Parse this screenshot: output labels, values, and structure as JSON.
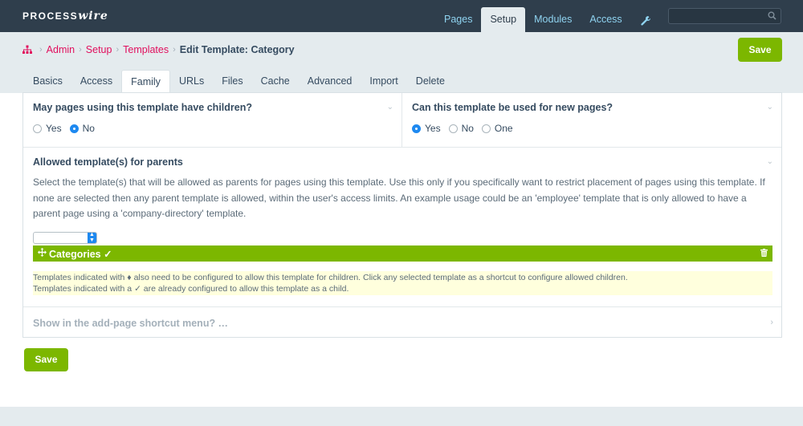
{
  "logo": {
    "process": "PROCESS",
    "wire": "wire"
  },
  "topnav": [
    {
      "label": "Pages",
      "active": false
    },
    {
      "label": "Setup",
      "active": true
    },
    {
      "label": "Modules",
      "active": false
    },
    {
      "label": "Access",
      "active": false
    }
  ],
  "search": {
    "placeholder": ""
  },
  "breadcrumb": {
    "items": [
      "Admin",
      "Setup",
      "Templates"
    ],
    "current": "Edit Template: Category"
  },
  "save_label": "Save",
  "tabs": [
    {
      "label": "Basics",
      "active": false
    },
    {
      "label": "Access",
      "active": false
    },
    {
      "label": "Family",
      "active": true
    },
    {
      "label": "URLs",
      "active": false
    },
    {
      "label": "Files",
      "active": false
    },
    {
      "label": "Cache",
      "active": false
    },
    {
      "label": "Advanced",
      "active": false
    },
    {
      "label": "Import",
      "active": false
    },
    {
      "label": "Delete",
      "active": false
    }
  ],
  "fields": {
    "children": {
      "label": "May pages using this template have children?",
      "options": [
        {
          "label": "Yes",
          "checked": false
        },
        {
          "label": "No",
          "checked": true
        }
      ]
    },
    "new_pages": {
      "label": "Can this template be used for new pages?",
      "options": [
        {
          "label": "Yes",
          "checked": true
        },
        {
          "label": "No",
          "checked": false
        },
        {
          "label": "One",
          "checked": false
        }
      ]
    },
    "parents": {
      "label": "Allowed template(s) for parents",
      "description": "Select the template(s) that will be allowed as parents for pages using this template. Use this only if you specifically want to restrict placement of pages using this template. If none are selected then any parent template is allowed, within the user's access limits. An example usage could be an 'employee' template that is only allowed to have a parent page using a 'company-directory' template.",
      "selected_item": "Categories ✓",
      "note_line1": "Templates indicated with ♦ also need to be configured to allow this template for children. Click any selected template as a shortcut to configure allowed children.",
      "note_line2": "Templates indicated with a ✓ are already configured to allow this template as a child."
    },
    "shortcut": {
      "label": "Show in the add-page shortcut menu? …"
    }
  },
  "colors": {
    "accent_green": "#7cb700",
    "link_pink": "#e10f5d",
    "topbar": "#2f3e4c",
    "radio_blue": "#1e89f0"
  }
}
